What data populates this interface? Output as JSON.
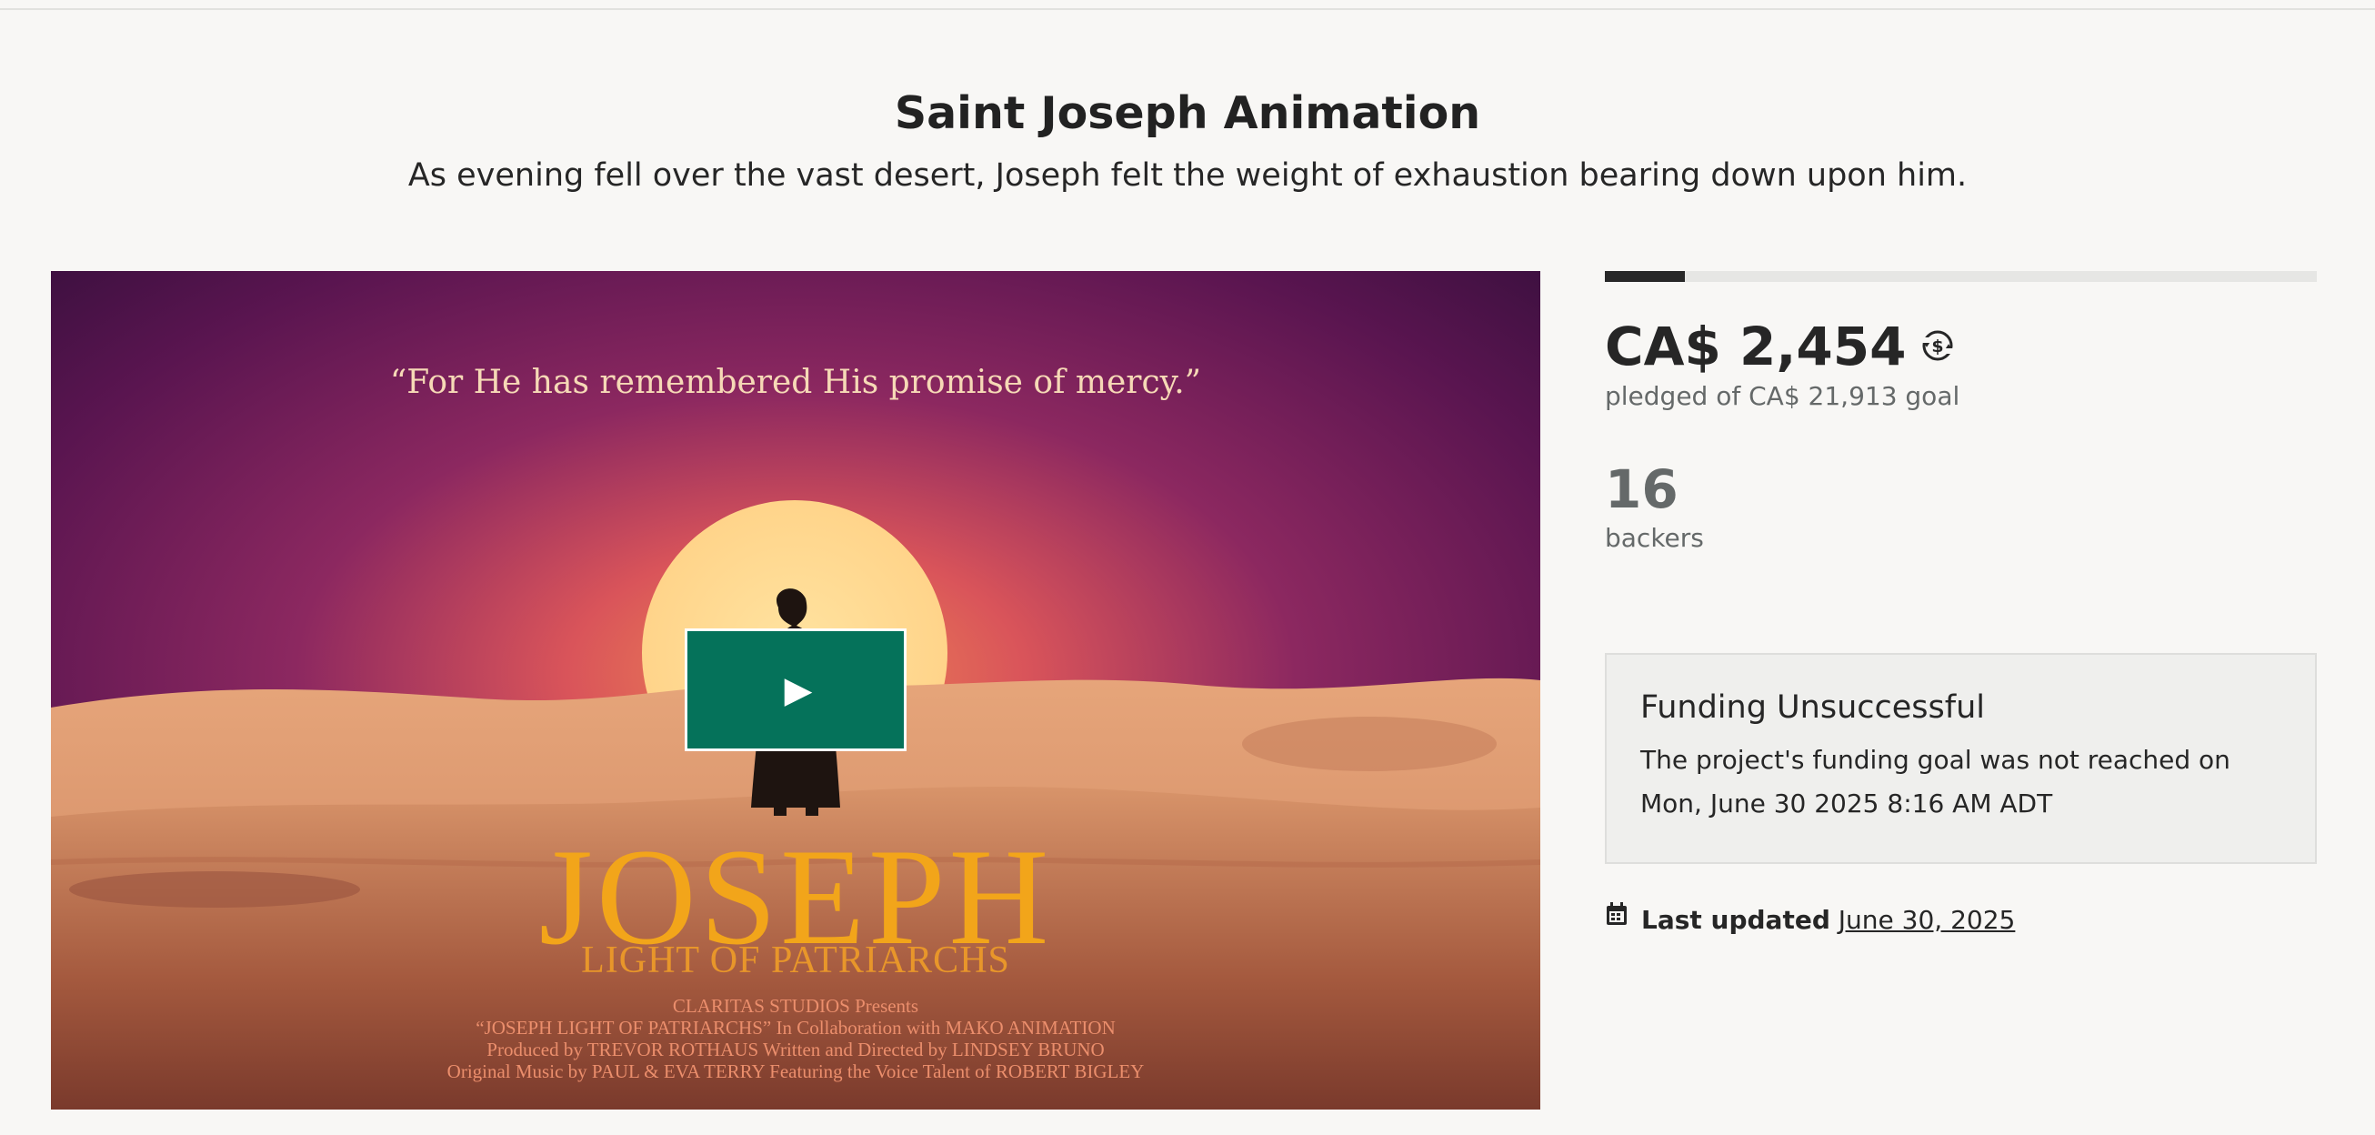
{
  "project": {
    "title": "Saint Joseph Animation",
    "blurb": "As evening fell over the vast desert, Joseph felt the weight of exhaustion bearing down upon him."
  },
  "hero": {
    "quote": "“For He has remembered His promise of mercy.”",
    "logo_title": "JOSEPH",
    "logo_subtitle": "LIGHT OF PATRIARCHS",
    "credits": [
      "CLARITAS STUDIOS Presents",
      "“JOSEPH LIGHT OF PATRIARCHS” In Collaboration with MAKO ANIMATION",
      "Produced by TREVOR ROTHAUS  Written and Directed by LINDSEY BRUNO",
      "Original Music by PAUL & EVA TERRY  Featuring the Voice Talent of ROBERT BIGLEY"
    ],
    "play_icon": "play-icon"
  },
  "funding": {
    "progress_fraction": 0.112,
    "pledged": "CA$ 2,454",
    "currency_icon": "currency-conversion-icon",
    "goal_text": "pledged of CA$ 21,913 goal",
    "backers_count": "16",
    "backers_label": "backers"
  },
  "status": {
    "heading": "Funding Unsuccessful",
    "message": "The project's funding goal was not reached on Mon, June 30 2025 8:16 AM ADT"
  },
  "updated": {
    "icon": "calendar-icon",
    "label": "Last updated",
    "date": "June 30, 2025"
  },
  "colors": {
    "background": "#f8f7f5",
    "play_button": "#05725a",
    "progress_fill": "#282828",
    "progress_track": "#e6e6e4"
  }
}
